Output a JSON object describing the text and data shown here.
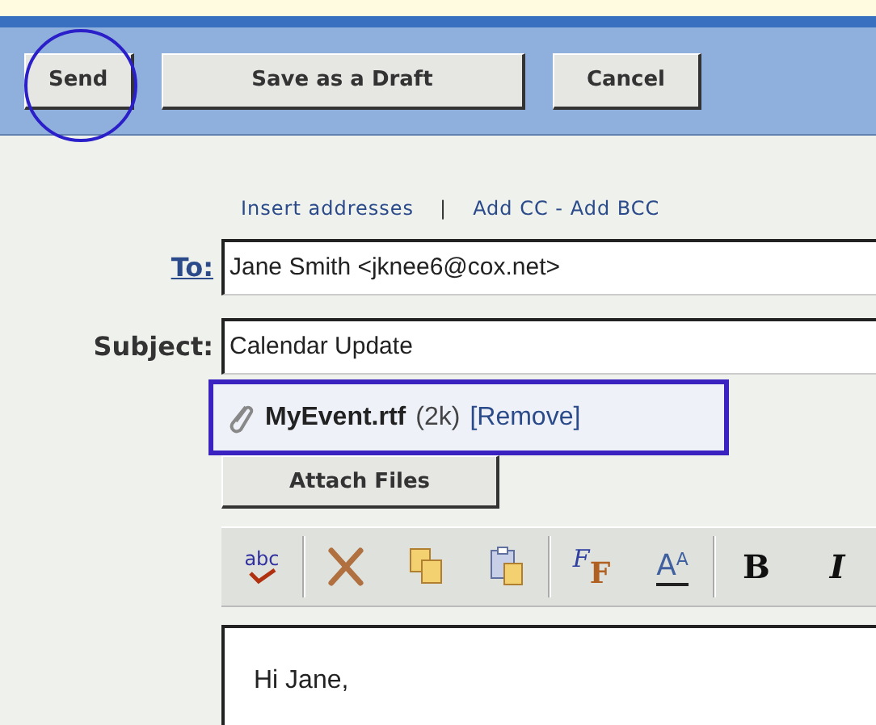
{
  "toolbar": {
    "buttons": [
      {
        "label": "Send",
        "highlighted": true
      },
      {
        "label": "Save as a Draft",
        "highlighted": false
      },
      {
        "label": "Cancel",
        "highlighted": false
      }
    ]
  },
  "links": [
    {
      "label": "Insert addresses"
    },
    {
      "label": "Add CC - Add BCC"
    }
  ],
  "separator": "|",
  "to": {
    "label": "To:",
    "value": "Jane Smith <jknee6@cox.net>"
  },
  "subject": {
    "label": "Subject:",
    "value": "Calendar Update"
  },
  "attachment": {
    "name": "MyEvent.rtf",
    "size": "(2k)",
    "remove": "[Remove]",
    "highlighted": true
  },
  "attach_button": "Attach Files",
  "editor_toolbar": [
    {
      "kind": "spell",
      "label": "abc"
    },
    {
      "kind": "cut"
    },
    {
      "kind": "copy"
    },
    {
      "kind": "paste"
    },
    {
      "kind": "font",
      "label": "F",
      "label2": "F"
    },
    {
      "kind": "size",
      "label": "A",
      "label2": "A"
    },
    {
      "kind": "bold",
      "label": "B"
    },
    {
      "kind": "italic",
      "label": "I"
    }
  ],
  "body": "Hi Jane,"
}
